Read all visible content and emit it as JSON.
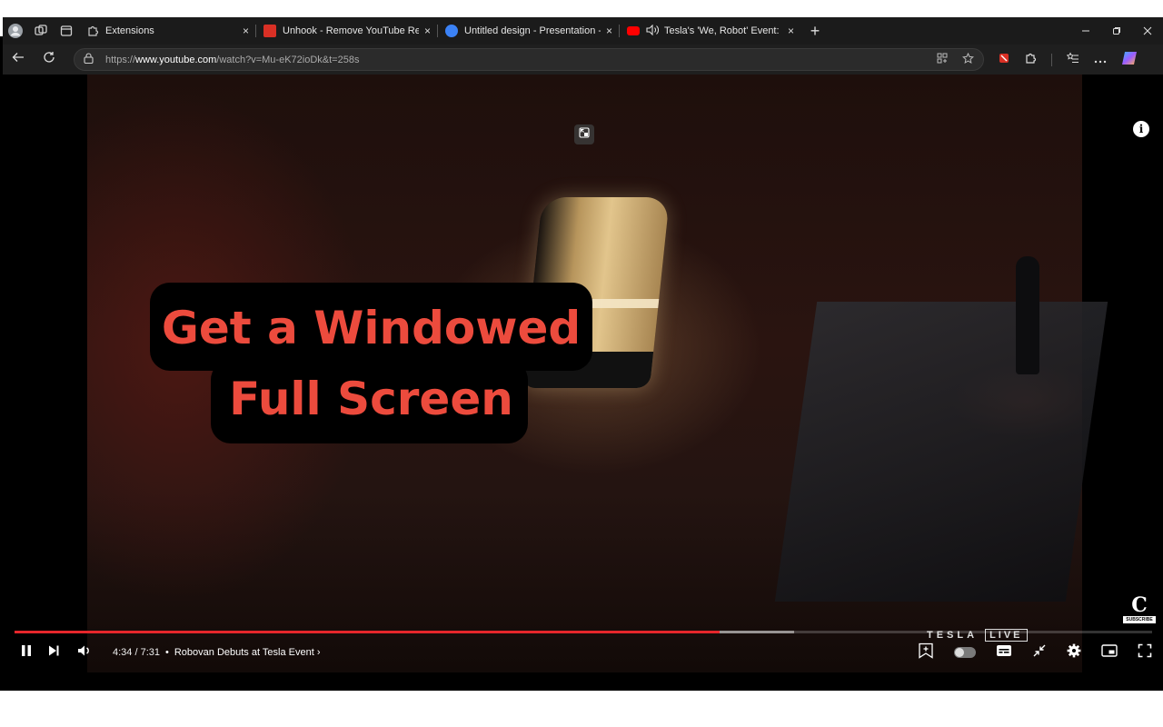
{
  "browser": {
    "tabs": [
      {
        "title": "Extensions",
        "active": false,
        "favicon_color": "#c8c8c8"
      },
      {
        "title": "Unhook - Remove YouTube Recor",
        "active": false,
        "favicon_color": "#d93025"
      },
      {
        "title": "Untitled design - Presentation - C",
        "active": false,
        "favicon_color": "#3b82f6"
      },
      {
        "title": "Tesla's 'We, Robot' Event: Eve",
        "active": true,
        "favicon_color": "#ff0000"
      }
    ],
    "close_glyph": "×",
    "new_tab_glyph": "+",
    "url_prefix": "https://",
    "url_host": "www.youtube.com",
    "url_path": "/watch?v=Mu-eK72ioDk&t=258s"
  },
  "video": {
    "caption_line1": "Get a Windowed",
    "caption_line2": "Full Screen",
    "info_glyph": "i",
    "channel_logo_letter": "C",
    "channel_logo_sub": "SUBSCRIBE",
    "watermark_brand": "TESLA",
    "watermark_live": "LIVE",
    "progress_played_fraction": 0.62,
    "progress_loaded_fraction": 0.685,
    "time_display": "4:34 / 7:31",
    "chapter_title": "Robovan Debuts at Tesla Event",
    "chapter_sep": "•",
    "chapter_chevron": "›"
  },
  "colors": {
    "accent_red": "#e6262b",
    "caption_red": "#ec4b3d"
  }
}
